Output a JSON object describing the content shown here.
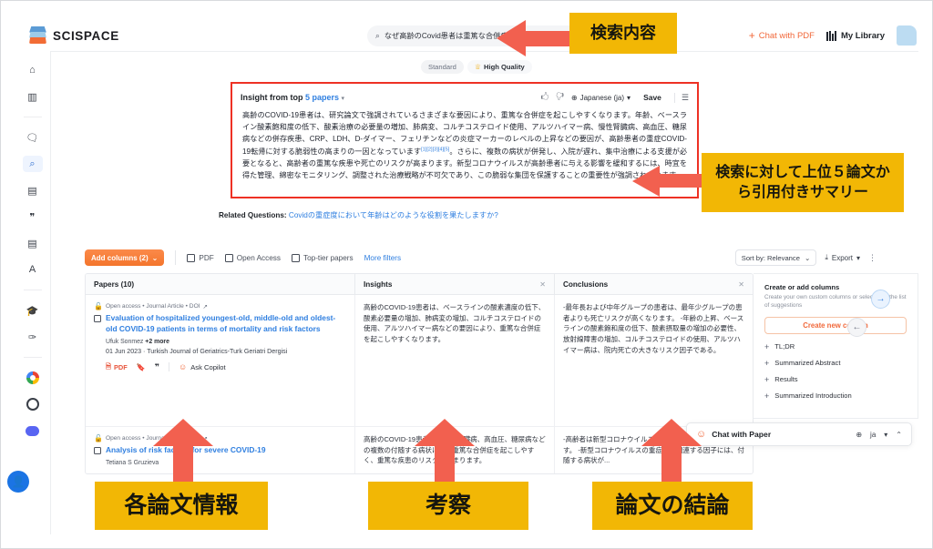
{
  "brand": {
    "name": "SCISPACE"
  },
  "search": {
    "value": "なぜ高齢のCovid患者は重篤な合併症を起こしやすいのか？",
    "icon": "search-icon"
  },
  "topbar": {
    "chat_with_pdf": "Chat with PDF",
    "plus": "+",
    "my_library": "My Library"
  },
  "rail": {
    "items": [
      {
        "name": "home",
        "glyph": "⌂"
      },
      {
        "name": "library",
        "glyph": "▥"
      },
      {
        "name": "chat",
        "glyph": "💬"
      },
      {
        "name": "search",
        "glyph": "⌕"
      },
      {
        "name": "notebook",
        "glyph": "▤"
      },
      {
        "name": "citations",
        "glyph": "❞"
      },
      {
        "name": "extract",
        "glyph": "▤"
      },
      {
        "name": "paraphrase",
        "glyph": "A"
      },
      {
        "name": "academic",
        "glyph": "🎓"
      },
      {
        "name": "rocket",
        "glyph": "✒"
      },
      {
        "name": "chrome-extension",
        "glyph": ""
      },
      {
        "name": "openai",
        "glyph": ""
      },
      {
        "name": "discord",
        "glyph": ""
      }
    ],
    "avatar": "👤"
  },
  "quality": {
    "standard": "Standard",
    "high_quality": "High Quality",
    "crown": "♕"
  },
  "insight": {
    "title_pre": "Insight from top ",
    "count": "5",
    "title_post": " papers",
    "caret": "▾",
    "thumbs_up": "🖒",
    "thumbs_down": "🖓",
    "language": "Japanese (ja)",
    "globe": "⊕",
    "lang_caret": "▾",
    "save": "Save",
    "list_icon": "☰",
    "body_p1": "高齢のCOVID-19患者は、研究論文で強調されているさまざまな要因により、重篤な合併症を起こしやすくなります。年齢、ベースライン酸素飽和度の低下、酸素治療の必要量の増加、肺病変、コルチコステロイド使用、アルツハイマー病、慢性腎臓病、高血圧、糖尿病などの併存疾患、CRP、LDH、D-ダイマー、フェリチンなどの炎症マーカーのレベルの上昇などの要因が、高齢患者の重症COVID-19転帰に対する脆弱性の高まりの一因となっています",
    "refs": [
      "[1]",
      "[2]",
      "[3]",
      "[4]",
      "[5]"
    ],
    "body_p2": "。さらに、複数の病状が併発し、入院が遅れ、集中治療による支援が必要となると、高齢者の重篤な疾患や死亡のリスクが高まります。新型コロナウイルスが高齢患者に与える影響を緩和するには、時宜を得た管理、綿密なモニタリング、調整された治療戦略が不可欠であり、この脆弱な集団を保護することの重要性が強調されています。"
  },
  "related": {
    "label": "Related Questions:",
    "question": "Covidの重症度において年齢はどのような役割を果たしますか?"
  },
  "filters": {
    "add_columns": "Add columns (2)",
    "add_caret": "⌄",
    "pdf": "PDF",
    "open_access": "Open Access",
    "top_tier": "Top-tier papers",
    "more_filters": "More filters",
    "sort_by": "Sort by: Relevance",
    "sort_caret": "⌄",
    "export": "Export",
    "export_caret": "▾",
    "export_icon": "⤓",
    "kebab": "⋮"
  },
  "table": {
    "columns": [
      {
        "label": "Papers (10)",
        "closable": false
      },
      {
        "label": "Insights",
        "closable": true,
        "close": "✕"
      },
      {
        "label": "Conclusions",
        "closable": true,
        "close": "✕"
      }
    ],
    "rows": [
      {
        "meta": "Open access • Journal Article • DOI",
        "meta_lock": "🔓",
        "meta_ext": "↗",
        "title": "Evaluation of hospitalized youngest-old, middle-old and oldest-old COVID-19 patients in terms of mortality and risk factors",
        "authors": "Ufuk Sonmez",
        "authors_more": "+2 more",
        "date": "01 Jun 2023 · Turkish Journal of Geriatrics-Turk Geriatri Dergisi",
        "pdf": "PDF",
        "bookmark": "🔖",
        "quote": "❞",
        "ask_copilot": "Ask Copilot",
        "insight": "高齢のCOVID-19患者は、ベースラインの酸素濃度の低下、酸素必要量の増加、肺病変の増加、コルチコステロイドの使用、アルツハイマー病などの要因により、重篤な合併症を起こしやすくなります。",
        "conclusion": "-最年長および中年グループの患者は、最年少グループの患者よりも死亡リスクが高くなります。 -年齢の上昇、ベースラインの酸素飽和度の低下、酸素摂取量の増加の必要性、放射線障害の増加、コルチコステロイドの使用、アルツハイマー病は、院内死亡の大きなリスク因子である。"
      },
      {
        "meta": "Open access • Journal Article • DOI",
        "meta_lock": "🔓",
        "meta_ext": "↗",
        "title": "Analysis of risk factors for severe COVID-19",
        "authors": "Tetiana S Gruzieva",
        "authors_more": "",
        "date": "",
        "pdf": "PDF",
        "bookmark": "🔖",
        "quote": "❞",
        "ask_copilot": "Ask Copilot",
        "insight": "高齢のCOVID-19患者は、慢性腎臓病、高血圧、糖尿病などの複数の付随する病状により重篤な合併症を起こしやすく、重篤な疾患のリスクが高まります。",
        "conclusion": "-高齢者は新型コロナウイルスの重症化リスクが高くなります。 -新型コロナウイルスの重症化に関連する因子には、付随する病状が..."
      }
    ]
  },
  "right_panel": {
    "title": "Create or add columns",
    "subtitle": "Create your own custom columns or select from the list of suggestions",
    "create_new": "Create new column",
    "create_new_pre": "Create new",
    "next_arrow": "→",
    "prev_arrow": "←",
    "suggestions": [
      {
        "plus": "+",
        "label": "TL;DR"
      },
      {
        "plus": "+",
        "label": "Summarized Abstract"
      },
      {
        "plus": "+",
        "label": "Results"
      },
      {
        "plus": "+",
        "label": "Summarized Introduction"
      }
    ]
  },
  "chat_dock": {
    "bubble": "💬",
    "label": "Chat with Paper",
    "globe": "⊕",
    "lang": "ja",
    "caret": "▾",
    "collapse": "⌃"
  },
  "annotations": [
    {
      "name": "search-content",
      "text": "検索内容"
    },
    {
      "name": "insight-summary",
      "text": "検索に対して上位５論文から引用付きサマリー"
    },
    {
      "name": "paper-info",
      "text": "各論文情報"
    },
    {
      "name": "insights-col",
      "text": "考察"
    },
    {
      "name": "conclusions-col",
      "text": "論文の結論"
    }
  ],
  "colors": {
    "accent_orange": "#f1683a",
    "link_blue": "#2f7fe0",
    "highlight_red": "#ee3124",
    "annotation_yellow": "#f2b705",
    "arrow_red": "#f2604f"
  }
}
